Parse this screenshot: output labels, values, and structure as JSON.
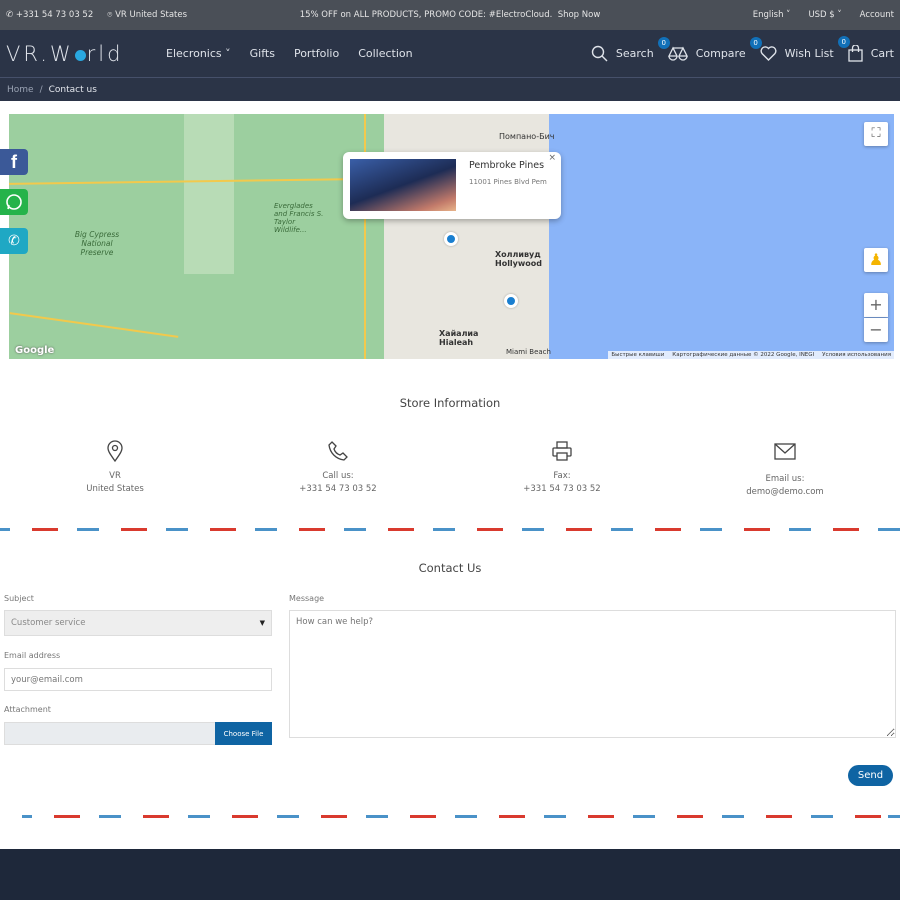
{
  "topbar": {
    "phone": "+331 54 73 03 52",
    "location": "VR United States",
    "promo": "15% OFF on ALL PRODUCTS, PROMO CODE: #ElectroCloud.",
    "shop_now": "Shop Now",
    "language": "English",
    "currency": "USD $",
    "account": "Account"
  },
  "header": {
    "logo": "VR.World",
    "nav": [
      "Elecronics",
      "Gifts",
      "Portfolio",
      "Collection"
    ],
    "search": "Search",
    "compare": "Compare",
    "compare_count": "0",
    "wishlist": "Wish List",
    "wishlist_count": "0",
    "cart": "Cart",
    "cart_count": "0"
  },
  "breadcrumb": {
    "home": "Home",
    "current": "Contact us"
  },
  "map": {
    "popup_title": "Pembroke Pines",
    "popup_address": "11001 Pines Blvd Pem",
    "close": "×",
    "footer": [
      "Быстрые клавиши",
      "Картографические данные © 2022 Google, INEGI",
      "Условия использования"
    ],
    "google": "Google",
    "labels": [
      "Помпано-Бич",
      "Everglades and Francis S. Taylor Wildlife...",
      "Big Cypress National Preserve",
      "Холливуд Hollywood",
      "Хайалиа Hialeah",
      "Miami Beach"
    ]
  },
  "store": {
    "title": "Store Information",
    "items": [
      {
        "icon": "location-pin-icon",
        "line1": "VR",
        "line2": "United States"
      },
      {
        "icon": "phone-icon",
        "line1": "Call us:",
        "line2": "+331 54 73 03 52"
      },
      {
        "icon": "printer-icon",
        "line1": "Fax:",
        "line2": "+331 54 73 03 52"
      },
      {
        "icon": "envelope-icon",
        "line1": "Email us:",
        "line2": "demo@demo.com"
      }
    ]
  },
  "contact": {
    "title": "Contact Us",
    "subject_label": "Subject",
    "subject_value": "Customer service",
    "email_label": "Email address",
    "email_placeholder": "your@email.com",
    "attachment_label": "Attachment",
    "choose_file": "Choose File",
    "message_label": "Message",
    "message_placeholder": "How can we help?",
    "send": "Send"
  },
  "colors": {
    "accent": "#1170b8",
    "header_bg": "#2b3447",
    "topbar_bg": "#4a4f57",
    "facebook": "#3b5998",
    "whatsapp": "#25b34a",
    "call": "#1fa8c4"
  }
}
